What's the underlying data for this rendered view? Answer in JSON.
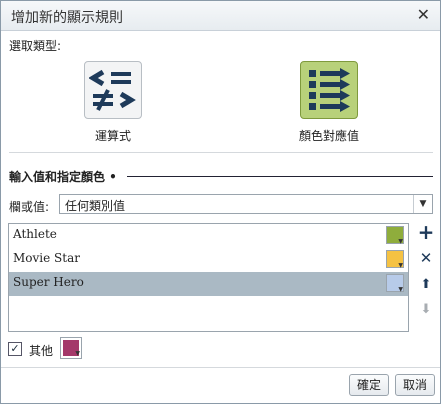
{
  "dialog": {
    "title": "增加新的顯示規則",
    "close_symbol": "✕"
  },
  "rule_type": {
    "label": "選取類型:",
    "options": [
      {
        "label": "運算式",
        "icon": "operator-icon",
        "selected": false
      },
      {
        "label": "顏色對應值",
        "icon": "color-mapping-icon",
        "selected": true
      }
    ]
  },
  "section": {
    "title": "輸入值和指定顏色 •"
  },
  "column": {
    "label": "欄或值:",
    "selected_value": "任何類別值"
  },
  "list": {
    "items": [
      {
        "label": "Athlete",
        "color": "#8fad3c",
        "selected": false
      },
      {
        "label": "Movie Star",
        "color": "#f5c243",
        "selected": false
      },
      {
        "label": "Super Hero",
        "color": "#b7cbe9",
        "selected": true
      }
    ]
  },
  "side_actions": [
    {
      "name": "add-icon",
      "symbol": "+"
    },
    {
      "name": "delete-icon",
      "symbol": "✕"
    },
    {
      "name": "move-up-icon",
      "symbol": "⬆"
    },
    {
      "name": "move-down-icon",
      "symbol": "⬇"
    }
  ],
  "other": {
    "label": "其他",
    "checked": true,
    "check_symbol": "✓",
    "color": "#a4386a"
  },
  "footer": {
    "ok_label": "確定",
    "cancel_label": "取消"
  },
  "colors": {
    "accent": "#1e3a5a",
    "selection": "#aab9c4"
  }
}
